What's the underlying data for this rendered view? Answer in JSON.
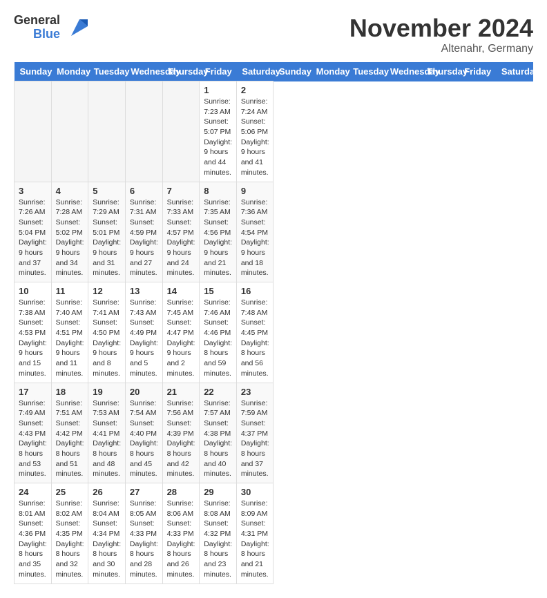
{
  "header": {
    "logo_general": "General",
    "logo_blue": "Blue",
    "month_title": "November 2024",
    "location": "Altenahr, Germany"
  },
  "days_of_week": [
    "Sunday",
    "Monday",
    "Tuesday",
    "Wednesday",
    "Thursday",
    "Friday",
    "Saturday"
  ],
  "weeks": [
    [
      {
        "day": "",
        "info": ""
      },
      {
        "day": "",
        "info": ""
      },
      {
        "day": "",
        "info": ""
      },
      {
        "day": "",
        "info": ""
      },
      {
        "day": "",
        "info": ""
      },
      {
        "day": "1",
        "info": "Sunrise: 7:23 AM\nSunset: 5:07 PM\nDaylight: 9 hours and 44 minutes."
      },
      {
        "day": "2",
        "info": "Sunrise: 7:24 AM\nSunset: 5:06 PM\nDaylight: 9 hours and 41 minutes."
      }
    ],
    [
      {
        "day": "3",
        "info": "Sunrise: 7:26 AM\nSunset: 5:04 PM\nDaylight: 9 hours and 37 minutes."
      },
      {
        "day": "4",
        "info": "Sunrise: 7:28 AM\nSunset: 5:02 PM\nDaylight: 9 hours and 34 minutes."
      },
      {
        "day": "5",
        "info": "Sunrise: 7:29 AM\nSunset: 5:01 PM\nDaylight: 9 hours and 31 minutes."
      },
      {
        "day": "6",
        "info": "Sunrise: 7:31 AM\nSunset: 4:59 PM\nDaylight: 9 hours and 27 minutes."
      },
      {
        "day": "7",
        "info": "Sunrise: 7:33 AM\nSunset: 4:57 PM\nDaylight: 9 hours and 24 minutes."
      },
      {
        "day": "8",
        "info": "Sunrise: 7:35 AM\nSunset: 4:56 PM\nDaylight: 9 hours and 21 minutes."
      },
      {
        "day": "9",
        "info": "Sunrise: 7:36 AM\nSunset: 4:54 PM\nDaylight: 9 hours and 18 minutes."
      }
    ],
    [
      {
        "day": "10",
        "info": "Sunrise: 7:38 AM\nSunset: 4:53 PM\nDaylight: 9 hours and 15 minutes."
      },
      {
        "day": "11",
        "info": "Sunrise: 7:40 AM\nSunset: 4:51 PM\nDaylight: 9 hours and 11 minutes."
      },
      {
        "day": "12",
        "info": "Sunrise: 7:41 AM\nSunset: 4:50 PM\nDaylight: 9 hours and 8 minutes."
      },
      {
        "day": "13",
        "info": "Sunrise: 7:43 AM\nSunset: 4:49 PM\nDaylight: 9 hours and 5 minutes."
      },
      {
        "day": "14",
        "info": "Sunrise: 7:45 AM\nSunset: 4:47 PM\nDaylight: 9 hours and 2 minutes."
      },
      {
        "day": "15",
        "info": "Sunrise: 7:46 AM\nSunset: 4:46 PM\nDaylight: 8 hours and 59 minutes."
      },
      {
        "day": "16",
        "info": "Sunrise: 7:48 AM\nSunset: 4:45 PM\nDaylight: 8 hours and 56 minutes."
      }
    ],
    [
      {
        "day": "17",
        "info": "Sunrise: 7:49 AM\nSunset: 4:43 PM\nDaylight: 8 hours and 53 minutes."
      },
      {
        "day": "18",
        "info": "Sunrise: 7:51 AM\nSunset: 4:42 PM\nDaylight: 8 hours and 51 minutes."
      },
      {
        "day": "19",
        "info": "Sunrise: 7:53 AM\nSunset: 4:41 PM\nDaylight: 8 hours and 48 minutes."
      },
      {
        "day": "20",
        "info": "Sunrise: 7:54 AM\nSunset: 4:40 PM\nDaylight: 8 hours and 45 minutes."
      },
      {
        "day": "21",
        "info": "Sunrise: 7:56 AM\nSunset: 4:39 PM\nDaylight: 8 hours and 42 minutes."
      },
      {
        "day": "22",
        "info": "Sunrise: 7:57 AM\nSunset: 4:38 PM\nDaylight: 8 hours and 40 minutes."
      },
      {
        "day": "23",
        "info": "Sunrise: 7:59 AM\nSunset: 4:37 PM\nDaylight: 8 hours and 37 minutes."
      }
    ],
    [
      {
        "day": "24",
        "info": "Sunrise: 8:01 AM\nSunset: 4:36 PM\nDaylight: 8 hours and 35 minutes."
      },
      {
        "day": "25",
        "info": "Sunrise: 8:02 AM\nSunset: 4:35 PM\nDaylight: 8 hours and 32 minutes."
      },
      {
        "day": "26",
        "info": "Sunrise: 8:04 AM\nSunset: 4:34 PM\nDaylight: 8 hours and 30 minutes."
      },
      {
        "day": "27",
        "info": "Sunrise: 8:05 AM\nSunset: 4:33 PM\nDaylight: 8 hours and 28 minutes."
      },
      {
        "day": "28",
        "info": "Sunrise: 8:06 AM\nSunset: 4:33 PM\nDaylight: 8 hours and 26 minutes."
      },
      {
        "day": "29",
        "info": "Sunrise: 8:08 AM\nSunset: 4:32 PM\nDaylight: 8 hours and 23 minutes."
      },
      {
        "day": "30",
        "info": "Sunrise: 8:09 AM\nSunset: 4:31 PM\nDaylight: 8 hours and 21 minutes."
      }
    ]
  ]
}
